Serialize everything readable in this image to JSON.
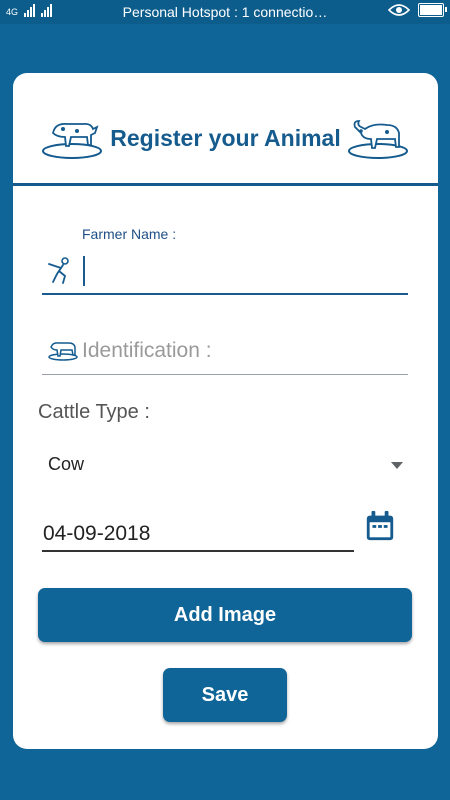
{
  "status_bar": {
    "network": "4G",
    "title": "Personal Hotspot : 1 connectio…",
    "icons": [
      "signal-icon",
      "eye-icon",
      "battery-icon"
    ]
  },
  "header": {
    "title": "Register your Animal"
  },
  "form": {
    "farmer_name": {
      "label": "Farmer Name :",
      "value": ""
    },
    "identification": {
      "placeholder": "Identification :"
    },
    "cattle_type": {
      "label": "Cattle Type :",
      "selected": "Cow"
    },
    "date": {
      "value": "04-09-2018"
    }
  },
  "buttons": {
    "add_image": "Add Image",
    "save": "Save"
  },
  "colors": {
    "primary": "#0f6597",
    "accent": "#155b8e",
    "card": "#ffffff"
  }
}
